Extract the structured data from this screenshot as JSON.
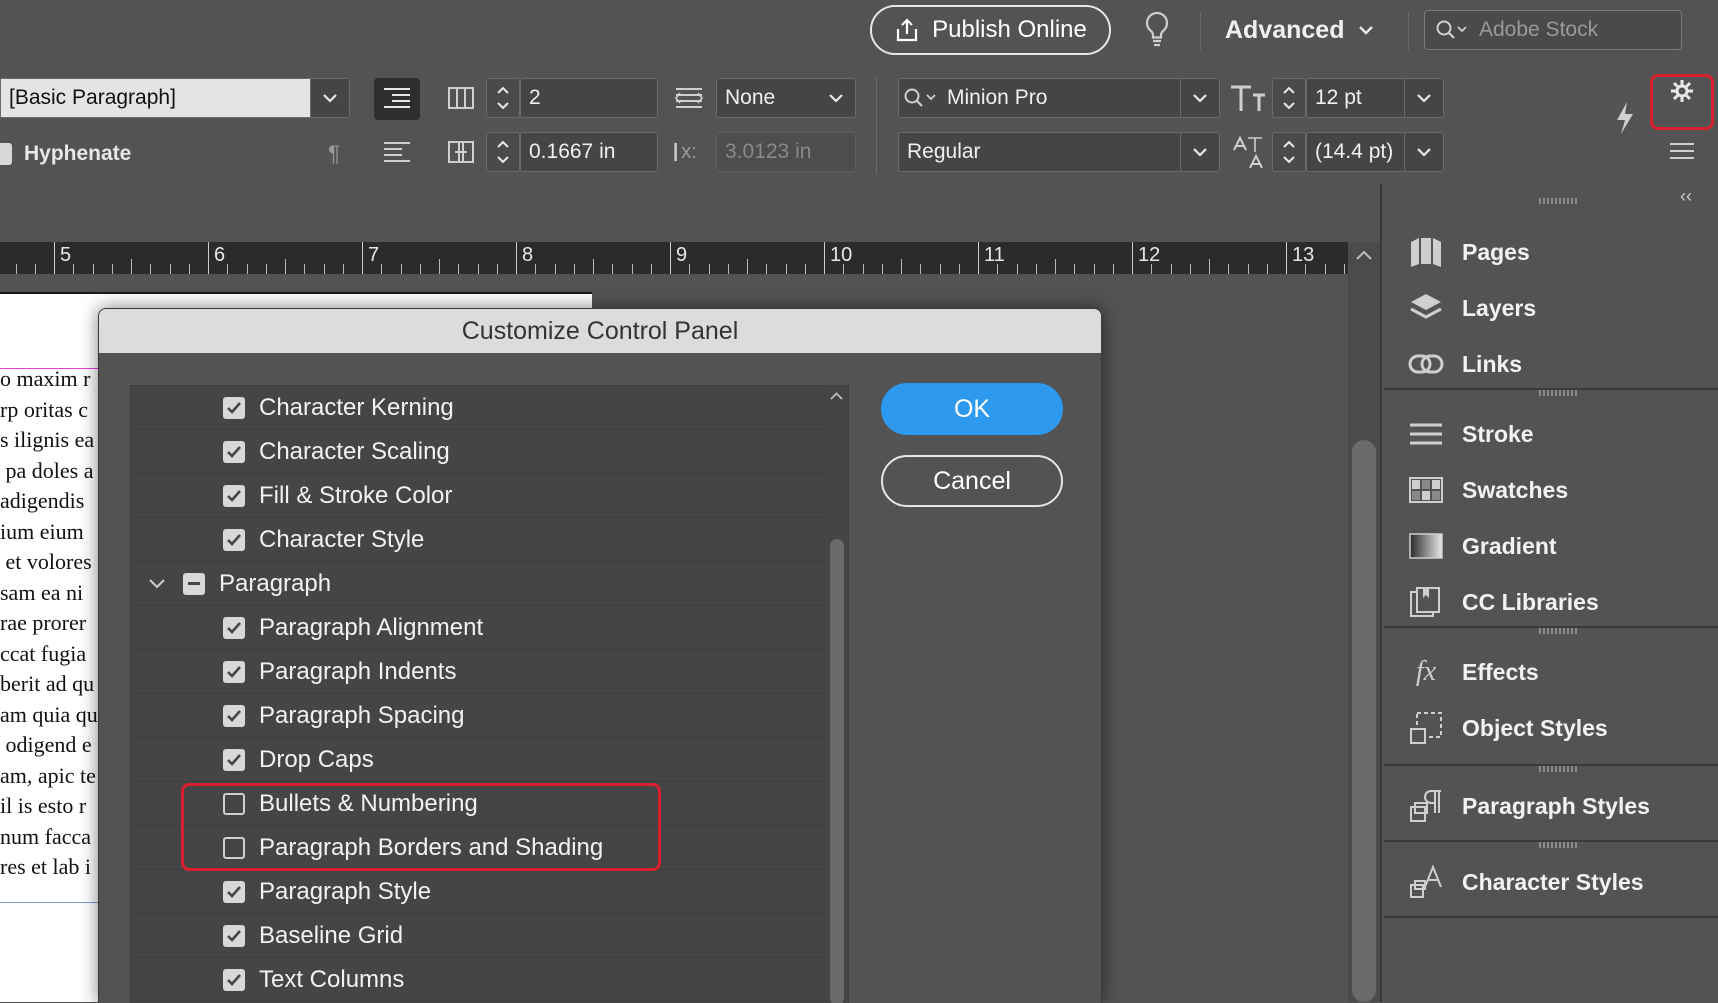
{
  "topbar": {
    "publish_label": "Publish Online",
    "workspace_label": "Advanced",
    "stock_placeholder": "Adobe Stock"
  },
  "control_panel": {
    "paragraph_style": "[Basic Paragraph]",
    "hyphenate_label": "Hyphenate",
    "columns_value": "2",
    "align_value": "None",
    "gutter_value": "0.1667 in",
    "x_label": "x:",
    "x_value": "3.0123 in",
    "font_family": "Minion Pro",
    "font_style": "Regular",
    "font_size": "12 pt",
    "leading": "(14.4 pt)"
  },
  "ruler": {
    "labels": [
      "5",
      "6",
      "7",
      "8",
      "9",
      "10",
      "11",
      "12",
      "13"
    ]
  },
  "page_text": {
    "lines": [
      "o maxim r",
      "rp oritas c",
      "s ilignis ea",
      " pa doles a",
      "adigendis",
      "ium eium",
      " et volores",
      "sam ea ni",
      "rae prorer",
      "ccat fugia",
      "berit ad qu",
      "am quia qu",
      " odigend e",
      "am, apic te",
      "il is esto r",
      "num facca",
      "res et lab i"
    ]
  },
  "dialog": {
    "title": "Customize Control Panel",
    "ok_label": "OK",
    "cancel_label": "Cancel",
    "rows": [
      {
        "label": "Character Kerning",
        "state": "checked",
        "level": 1
      },
      {
        "label": "Character Scaling",
        "state": "checked",
        "level": 1
      },
      {
        "label": "Fill & Stroke Color",
        "state": "checked",
        "level": 1
      },
      {
        "label": "Character Style",
        "state": "checked",
        "level": 1
      },
      {
        "label": "Paragraph",
        "state": "mixed",
        "level": 0
      },
      {
        "label": "Paragraph Alignment",
        "state": "checked",
        "level": 1
      },
      {
        "label": "Paragraph Indents",
        "state": "checked",
        "level": 1
      },
      {
        "label": "Paragraph Spacing",
        "state": "checked",
        "level": 1
      },
      {
        "label": "Drop Caps",
        "state": "checked",
        "level": 1
      },
      {
        "label": "Bullets & Numbering",
        "state": "unchecked",
        "level": 1
      },
      {
        "label": "Paragraph Borders and Shading",
        "state": "unchecked",
        "level": 1
      },
      {
        "label": "Paragraph Style",
        "state": "checked",
        "level": 1
      },
      {
        "label": "Baseline Grid",
        "state": "checked",
        "level": 1
      },
      {
        "label": "Text Columns",
        "state": "checked",
        "level": 1
      }
    ]
  },
  "dock": {
    "pages": "Pages",
    "layers": "Layers",
    "links": "Links",
    "stroke": "Stroke",
    "swatches": "Swatches",
    "gradient": "Gradient",
    "cc_libraries": "CC Libraries",
    "effects": "Effects",
    "effects_icon_text": "fx",
    "object_styles": "Object Styles",
    "paragraph_styles": "Paragraph Styles",
    "character_styles": "Character Styles",
    "collapse_glyph": "‹‹"
  },
  "colors": {
    "accent_blue": "#2d9af0",
    "highlight_red": "#d8202e",
    "ui_gray": "#535353"
  }
}
